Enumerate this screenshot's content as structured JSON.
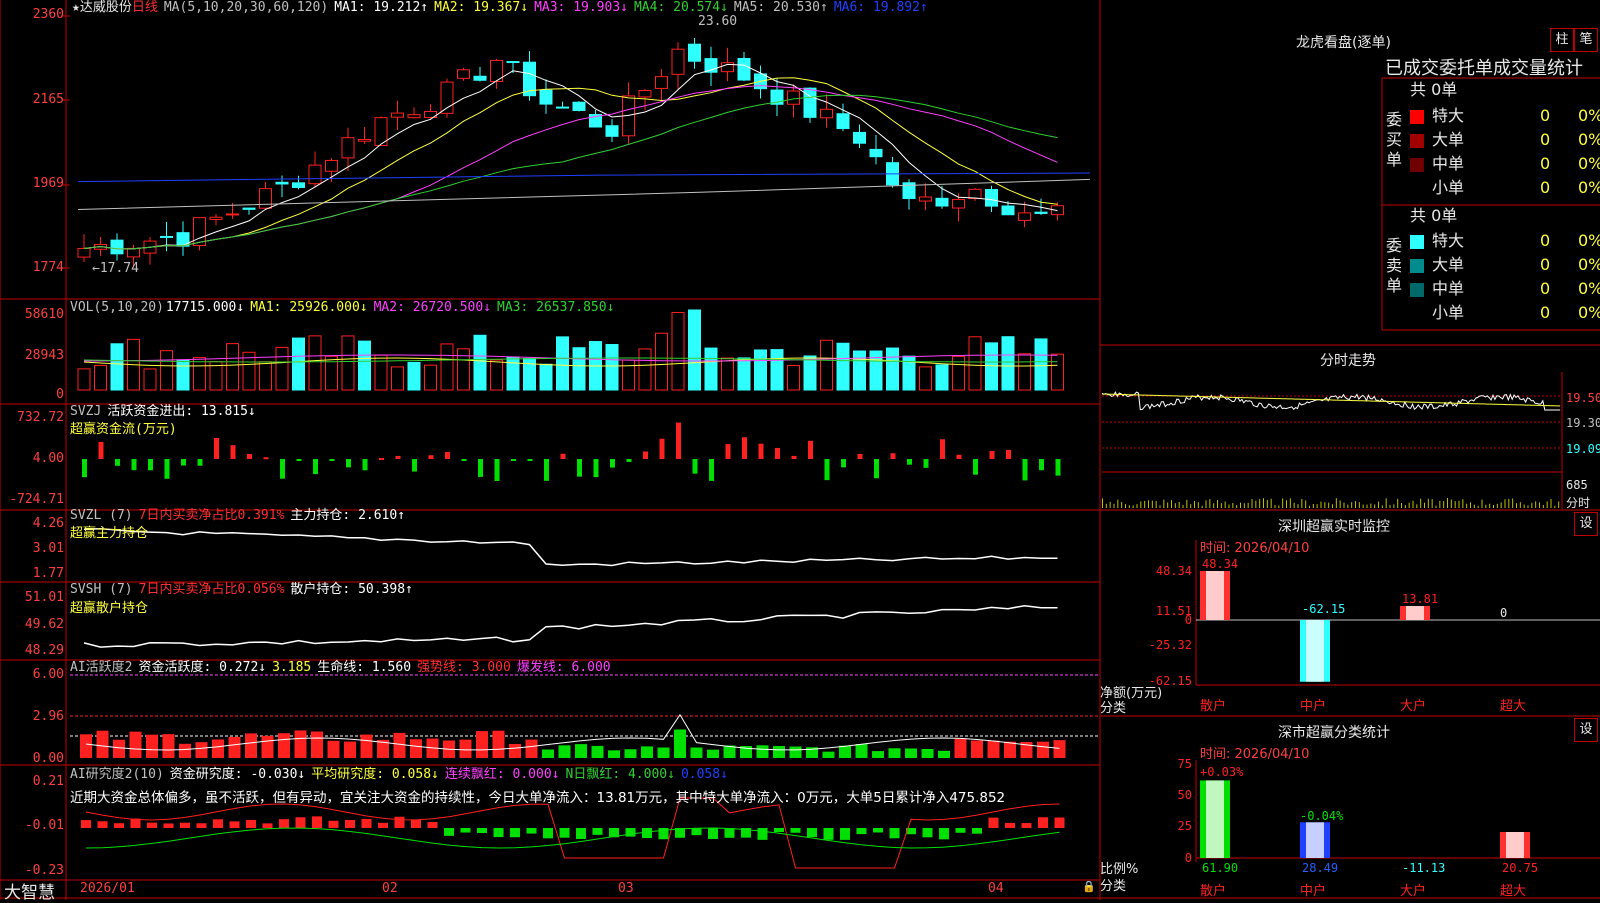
{
  "colors": {
    "up": "#ff2020",
    "down": "#30ffff",
    "ma1": "#ffffff",
    "ma2": "#ffff40",
    "ma3": "#ff40ff",
    "ma4": "#30d030",
    "ma5": "#c0c0c0",
    "ma6": "#2040ff",
    "grid": "#c00000",
    "green": "#00e000"
  },
  "main": {
    "title": "★达威股份",
    "period": "日线",
    "ma_label": "MA(5,10,20,30,60,120)",
    "ma1": "MA1: 19.212↑",
    "ma2": "MA2: 19.367↓",
    "ma3": "MA3: 19.903↓",
    "ma4": "MA4: 20.574↓",
    "ma5": "MA5: 20.530↑",
    "ma6": "MA6: 19.892↑",
    "yticks": [
      "2360",
      "2165",
      "1969",
      "1774"
    ],
    "high_label": "23.60",
    "low_label": "←17.74"
  },
  "vol": {
    "label": "VOL(5,10,20)",
    "value": "17715.000↓",
    "ma1": "MA1: 25926.000↓",
    "ma2": "MA2: 26720.500↓",
    "ma3": "MA3: 26537.850↓",
    "yticks": [
      "58610",
      "28943",
      "0"
    ]
  },
  "svzj": {
    "label": "SVZJ",
    "t1": "活跃资金进出: 13.815↓",
    "t2": "超赢资金流(万元)",
    "yticks": [
      "732.72",
      "4.00",
      "-724.71"
    ]
  },
  "svzl": {
    "label": "SVZL (7)",
    "t1": "7日内买卖净占比0.391%",
    "t2": "主力持仓: 2.610↑",
    "t3": "超赢主力持仓",
    "yticks": [
      "4.26",
      "3.01",
      "1.77"
    ]
  },
  "svsh": {
    "label": "SVSH (7)",
    "t1": "7日内买卖净占比0.056%",
    "t2": "散户持仓: 50.398↑",
    "t3": "超赢散户持仓",
    "yticks": [
      "51.01",
      "49.62",
      "48.29"
    ]
  },
  "ai1": {
    "label": "AI活跃度2",
    "t1": "资金活跃度: 0.272↓",
    "t2": "3.185",
    "t3": "生命线: 1.560",
    "t4": "强势线: 3.000",
    "t5": "爆发线: 6.000",
    "yticks": [
      "6.00",
      "2.96",
      "0.00"
    ]
  },
  "ai2": {
    "label": "AI研究度2(10)",
    "t1": "资金研究度: -0.030↓",
    "t2": "平均研究度: 0.058↓",
    "t3": "连续飘红: 0.000↓",
    "t4": "N日飘红: 4.000↓",
    "t5": "0.058↓",
    "comment": "近期大资金总体偏多，虽不活跃，但有异动，宜关注大资金的持续性，今日大单净流入：13.81万元，其中特大单净流入：0万元，大单5日累计净入475.852",
    "yticks": [
      "0.21",
      "-0.01",
      "-0.23"
    ]
  },
  "xaxis": {
    "brand": "大智慧",
    "labels": [
      "2026/01",
      "02",
      "03",
      "04"
    ]
  },
  "lhb": {
    "title": "龙虎看盘(逐单)",
    "btn1": "柱",
    "btn2": "笔",
    "header": "已成交委托单成交量统计",
    "buy_side": "委买单",
    "sell_side": "委卖单",
    "buy_total": "共 0单",
    "sell_total": "共 0单",
    "rows": [
      {
        "name": "特大",
        "v": "0",
        "p": "0%"
      },
      {
        "name": "大单",
        "v": "0",
        "p": "0%"
      },
      {
        "name": "中单",
        "v": "0",
        "p": "0%"
      },
      {
        "name": "小单",
        "v": "0",
        "p": "0%"
      }
    ]
  },
  "fenshi": {
    "title": "分时走势",
    "p1": "19.50",
    "p2": "19.30",
    "p3": "19.09",
    "vol": "685",
    "unit": "分时"
  },
  "szjk": {
    "title": "深圳超赢实时监控",
    "btn": "设",
    "time": "时间: 2026/04/10",
    "yticks": [
      "48.34",
      "11.51",
      "0",
      "-25.32",
      "-62.15"
    ],
    "ylabel": "净额(万元)",
    "xlabel": "分类",
    "cats": [
      "散户",
      "中户",
      "大户",
      "超大"
    ],
    "values": [
      48.34,
      -62.15,
      13.81,
      0
    ],
    "vlabels": [
      "48.34",
      "-62.15",
      "13.81",
      "0"
    ]
  },
  "fltj": {
    "title": "深市超赢分类统计",
    "btn": "设",
    "time": "时间: 2026/04/10",
    "yticks": [
      "75",
      "50",
      "25",
      "0"
    ],
    "ylabel": "比例%",
    "xlabel": "分类",
    "cats": [
      "散户",
      "中户",
      "大户",
      "超大"
    ],
    "top_labels": [
      "+0.03%",
      "-0.04%"
    ],
    "values": [
      61.9,
      28.49,
      -11.13,
      20.75
    ],
    "vlabels": [
      "61.90",
      "28.49",
      "-11.13",
      "20.75"
    ]
  }
}
